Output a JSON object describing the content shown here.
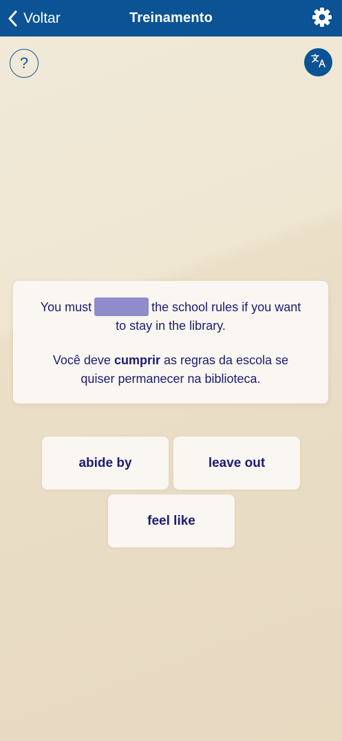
{
  "header": {
    "back_label": "Voltar",
    "title": "Treinamento",
    "bar_color": "#0b5394"
  },
  "toolbar": {
    "help_glyph": "?",
    "translate_icon": "translate-icon",
    "settings_icon": "gear-icon"
  },
  "exercise": {
    "sentence_before": "You must",
    "sentence_after": "the school rules if you want to stay in the library.",
    "translation_before": "Você deve",
    "translation_highlight": "cumprir",
    "translation_after": "as regras da escola se quiser permanecer na biblioteca.",
    "blank_color": "#8e8ccb",
    "text_color": "#1c1b72"
  },
  "options": [
    {
      "label": "abide by"
    },
    {
      "label": "leave out"
    },
    {
      "label": "feel like"
    }
  ]
}
